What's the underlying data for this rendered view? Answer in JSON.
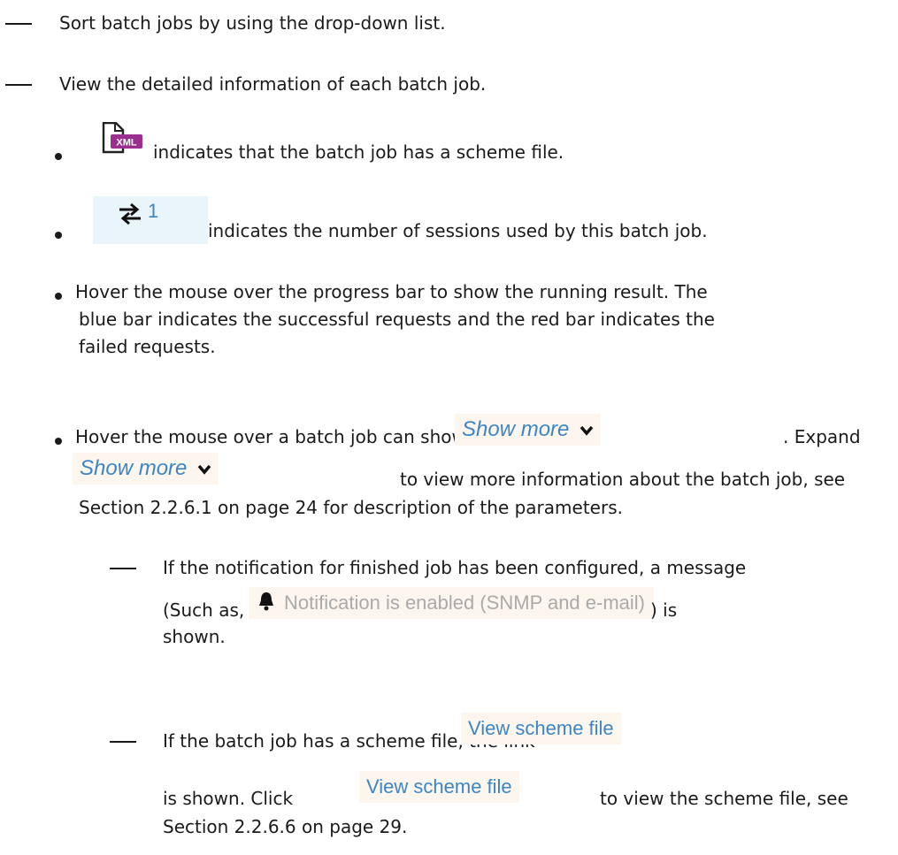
{
  "items": {
    "sort": "Sort batch jobs by using the drop-down list.",
    "view_detail": "View the detailed information of each batch job.",
    "xml_text": "indicates that the batch job has a scheme file.",
    "xml_icon_text": "XML",
    "sessions_count": "1",
    "sessions_text": "indicates the number of sessions used by this batch job.",
    "hover_progress_l1": "Hover the mouse over the progress bar to show the running result.  The",
    "hover_progress_l2": "blue bar indicates the successful requests and the red bar indicates the",
    "hover_progress_l3": "failed requests.",
    "hover_job_l1": "Hover the mouse over a batch job can show",
    "show_more": "Show more",
    "hover_job_l1_end": ". Expand",
    "hover_job_l2_end": "to view more information about the batch job, see",
    "hover_job_l3": "Section 2.2.6.1 on page 24 for description of the parameters.",
    "notif_l1": "If the notification for finished job has been configured, a message",
    "notif_l2_start": "(Such as,",
    "notif_chip": "Notification is enabled (SNMP and e-mail)",
    "notif_l2_end": ") is",
    "notif_l3": "shown.",
    "scheme_l1": "If the batch job has a scheme file, the link",
    "scheme_link": "View scheme file",
    "scheme_l2_start": "is shown.  Click",
    "scheme_l2_end": "to view the scheme file, see",
    "scheme_l3": "Section 2.2.6.6 on page 29."
  },
  "colors": {
    "link": "#3c86c6",
    "chip_bg": "#fdf6ee",
    "xml_badge": "#9b2f8f",
    "session_bg": "#eaf4fb"
  }
}
